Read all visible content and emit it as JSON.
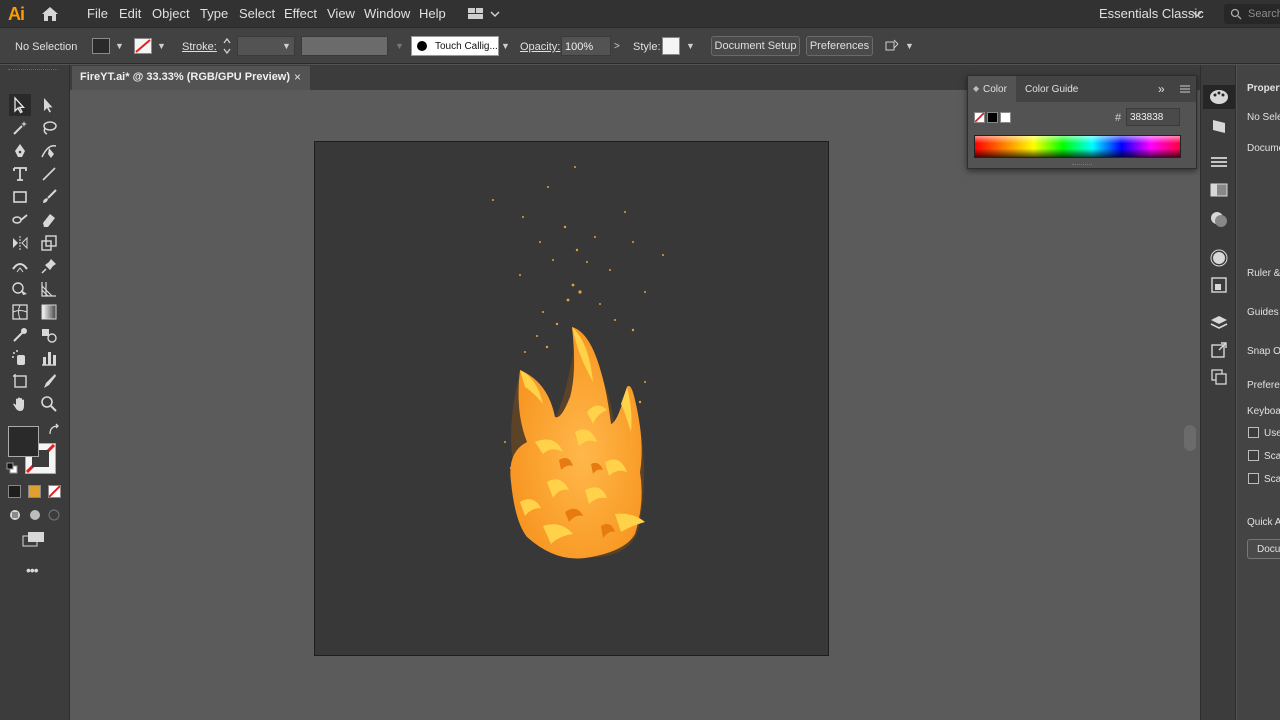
{
  "app": {
    "logo": "Ai",
    "workspace": "Essentials Classic",
    "search_placeholder": "Search"
  },
  "menu": [
    "File",
    "Edit",
    "Object",
    "Type",
    "Select",
    "Effect",
    "View",
    "Window",
    "Help"
  ],
  "control_bar": {
    "selection_status": "No Selection",
    "stroke_label": "Stroke:",
    "brush_name": "Touch Callig...",
    "opacity_label": "Opacity:",
    "opacity_value": "100%",
    "style_label": "Style:",
    "document_setup": "Document Setup",
    "preferences": "Preferences"
  },
  "document_tab": {
    "title": "FireYT.ai* @ 33.33% (RGB/GPU Preview)",
    "close": "×"
  },
  "color_panel": {
    "tab_color": "Color",
    "tab_color_guide": "Color Guide",
    "hash": "#",
    "hex_value": "383838"
  },
  "properties_panel": {
    "title": "Properties",
    "no_selection": "No Selection",
    "document": "Document",
    "ruler": "Ruler & Grids",
    "guides": "Guides",
    "snap": "Snap Options",
    "preferences": "Preferences",
    "keyboard": "Keyboard Increment",
    "use_preview": "Use Preview Bounds",
    "scale_corners": "Scale Corners",
    "scale_strokes": "Scale Strokes & Effects",
    "quick_actions": "Quick Actions",
    "document_setup_btn": "Document Setup"
  },
  "colors": {
    "artboard_bg": "#383838",
    "flame_outer": "#ff9f1c",
    "flame_inner": "#ffd23f",
    "accent": "#ff9a00"
  }
}
